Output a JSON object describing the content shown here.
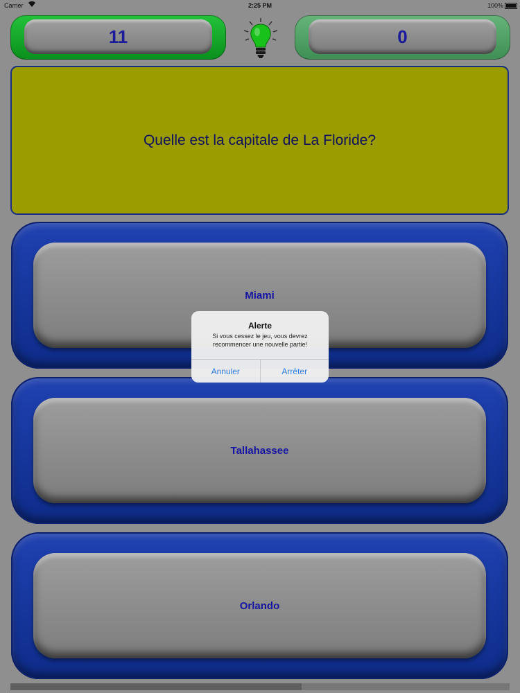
{
  "status": {
    "carrier": "Carrier",
    "time": "2:25 PM",
    "battery": "100%"
  },
  "scores": {
    "left": "11",
    "right": "0"
  },
  "question": {
    "text": "Quelle est la capitale de La Floride?"
  },
  "answers": [
    {
      "label": "Miami"
    },
    {
      "label": "Tallahassee"
    },
    {
      "label": "Orlando"
    }
  ],
  "alert": {
    "title": "Alerte",
    "message": "Si vous cessez le jeu, vous devrez recommencer une nouvelle partie!",
    "cancel": "Annuler",
    "stop": "Arrêter"
  },
  "icons": {
    "hint": "lightbulb-icon"
  },
  "colors": {
    "question_bg": "#9b9c00",
    "answer_frame": "#1f41b0",
    "score_left": "#23c23a",
    "score_right": "#67b47a"
  }
}
